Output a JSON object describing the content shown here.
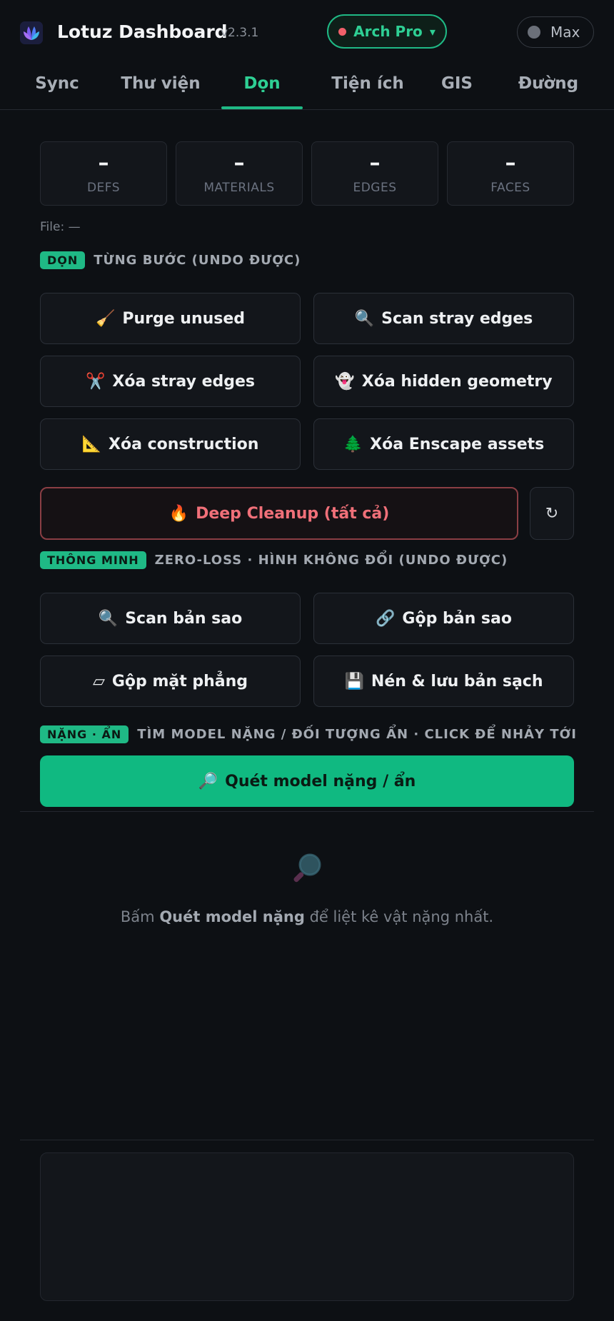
{
  "header": {
    "title": "Lotuz Dashboard",
    "version": "v2.3.1",
    "profile_label": "Arch Pro",
    "profile_caret": "▾",
    "mode_label": "Max",
    "colors": {
      "accent": "#1fb985",
      "danger": "#f07079",
      "background": "#0d1014"
    }
  },
  "tabs": [
    {
      "label": "Sync"
    },
    {
      "label": "Thư viện"
    },
    {
      "label": "Dọn",
      "active": true
    },
    {
      "label": "Tiện ích"
    },
    {
      "label": "GIS"
    },
    {
      "label": "Đường"
    }
  ],
  "stats": [
    {
      "value": "–",
      "label": "DEFS"
    },
    {
      "value": "–",
      "label": "MATERIALS"
    },
    {
      "value": "–",
      "label": "EDGES"
    },
    {
      "value": "–",
      "label": "FACES"
    }
  ],
  "file_line": "File: —",
  "section_clean": {
    "badge": "DỌN",
    "desc": "TỪNG BƯỚC (UNDO ĐƯỢC)"
  },
  "clean_buttons": [
    {
      "icon": "🧹",
      "label": "Purge unused"
    },
    {
      "icon": "🔍",
      "label": "Scan stray edges"
    },
    {
      "icon": "✂️",
      "label": "Xóa stray edges"
    },
    {
      "icon": "👻",
      "label": "Xóa hidden geometry"
    },
    {
      "icon": "📐",
      "label": "Xóa construction"
    },
    {
      "icon": "🌲",
      "label": "Xóa Enscape assets"
    }
  ],
  "deep_cleanup": {
    "icon": "🔥",
    "label": "Deep Cleanup (tất cả)"
  },
  "refresh_icon": "↻",
  "section_smart": {
    "badge": "THÔNG MINH",
    "desc": "ZERO-LOSS · HÌNH KHÔNG ĐỔI (UNDO ĐƯỢC)"
  },
  "smart_buttons": [
    {
      "icon": "🔍",
      "label": "Scan bản sao"
    },
    {
      "icon": "🔗",
      "label": "Gộp bản sao"
    },
    {
      "icon": "▱",
      "label": "Gộp mặt phẳng"
    },
    {
      "icon": "💾",
      "label": "Nén & lưu bản sạch"
    }
  ],
  "section_heavy": {
    "badge": "NẶNG · ẨN",
    "desc": "TÌM MODEL NẶNG / ĐỐI TƯỢNG ẨN · CLICK ĐỂ NHẢY TỚI"
  },
  "heavy_scan": {
    "icon": "🔎",
    "label": "Quét model nặng / ẩn"
  },
  "empty_state": {
    "prefix": "Bấm ",
    "bold": "Quét model nặng",
    "suffix": " để liệt kê vật nặng nhất."
  }
}
